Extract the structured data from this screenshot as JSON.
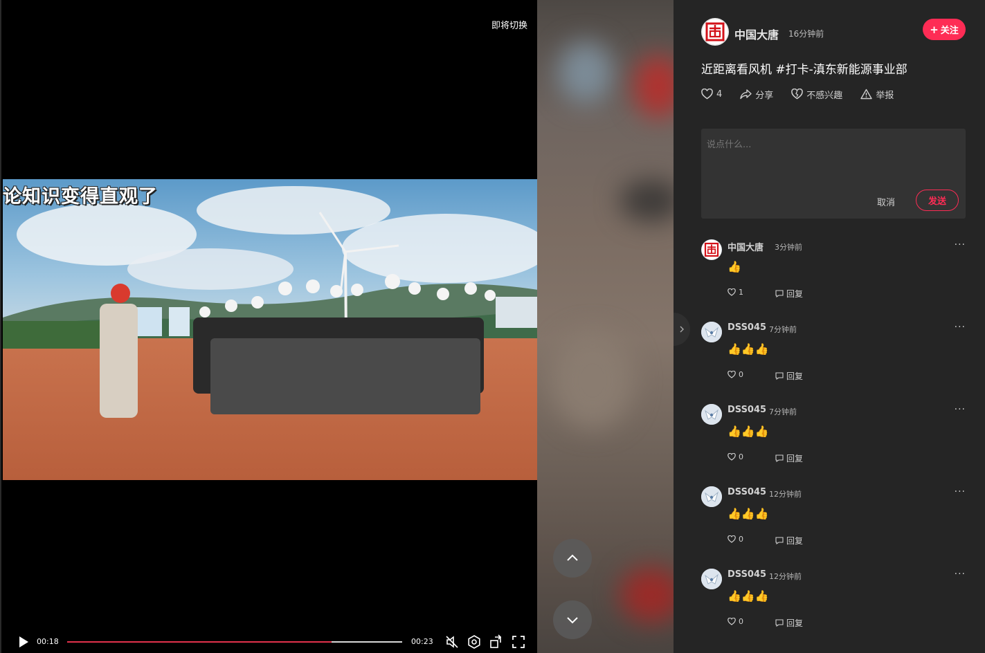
{
  "video": {
    "switch_label": "即将切换",
    "caption": "论知识变得直观了",
    "time_current": "00:18",
    "time_total": "00:23",
    "progress_fraction": 0.79
  },
  "author": {
    "name": "中国大唐",
    "time": "16分钟前",
    "follow_label": "关注"
  },
  "post": {
    "title": "近距离看风机 #打卡-滇东新能源事业部",
    "likes": "4",
    "share_label": "分享",
    "not_interested_label": "不感兴趣",
    "report_label": "举报"
  },
  "comment_box": {
    "placeholder": "说点什么...",
    "cancel_label": "取消",
    "send_label": "发送"
  },
  "comments": [
    {
      "name": "中国大唐",
      "time": "3分钟前",
      "body": "👍",
      "likes": "1",
      "reply_label": "回复",
      "avatar": "datang-logo"
    },
    {
      "name": "DSS045",
      "time": "7分钟前",
      "body": "👍👍👍",
      "likes": "0",
      "reply_label": "回复",
      "avatar": "user-avatar"
    },
    {
      "name": "DSS045",
      "time": "7分钟前",
      "body": "👍👍👍",
      "likes": "0",
      "reply_label": "回复",
      "avatar": "user-avatar"
    },
    {
      "name": "DSS045",
      "time": "12分钟前",
      "body": "👍👍👍",
      "likes": "0",
      "reply_label": "回复",
      "avatar": "user-avatar"
    },
    {
      "name": "DSS045",
      "time": "12分钟前",
      "body": "👍👍👍",
      "likes": "0",
      "reply_label": "回复",
      "avatar": "user-avatar"
    }
  ],
  "colors": {
    "accent": "#fe2c55",
    "panel": "#252525",
    "progress": "#e3324c"
  }
}
